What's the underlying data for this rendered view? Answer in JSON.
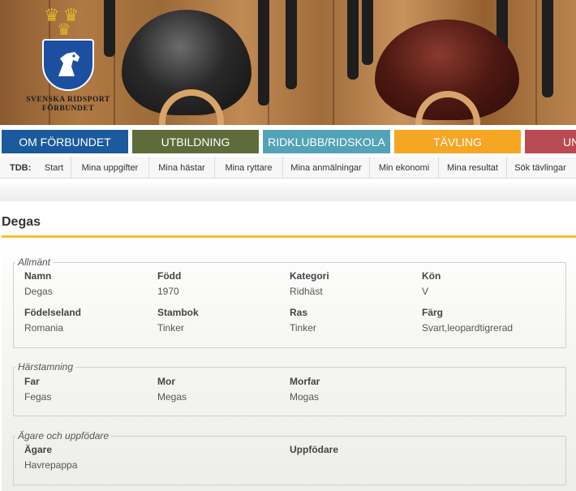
{
  "logo": {
    "line1": "SVENSKA RIDSPORT",
    "line2": "FÖRBUNDET"
  },
  "main_nav": [
    {
      "label": "OM FÖRBUNDET",
      "color": "#1b5a9c"
    },
    {
      "label": "UTBILDNING",
      "color": "#5f6b3a"
    },
    {
      "label": "RIDKLUBB/RIDSKOLA",
      "color": "#53a3b6"
    },
    {
      "label": "TÄVLING",
      "color": "#f5a623"
    },
    {
      "label": "UN",
      "color": "#b84a52"
    }
  ],
  "sub_nav": {
    "label": "TDB:",
    "items": [
      "Start",
      "Mina uppgifter",
      "Mina hästar",
      "Mina ryttare",
      "Mina anmälningar",
      "Min ekonomi",
      "Mina resultat",
      "Sök tävlingar"
    ]
  },
  "page": {
    "title": "Degas"
  },
  "general": {
    "legend": "Allmänt",
    "fields": [
      {
        "label": "Namn",
        "value": "Degas"
      },
      {
        "label": "Född",
        "value": "1970"
      },
      {
        "label": "Kategori",
        "value": "Ridhäst"
      },
      {
        "label": "Kön",
        "value": "V"
      },
      {
        "label": "Födelseland",
        "value": "Romania"
      },
      {
        "label": "Stambok",
        "value": "Tinker"
      },
      {
        "label": "Ras",
        "value": "Tinker"
      },
      {
        "label": "Färg",
        "value": "Svart,leopardtigrerad"
      }
    ]
  },
  "pedigree": {
    "legend": "Härstamning",
    "fields": [
      {
        "label": "Far",
        "value": "Fegas"
      },
      {
        "label": "Mor",
        "value": "Megas"
      },
      {
        "label": "Morfar",
        "value": "Mogas"
      }
    ]
  },
  "owner": {
    "legend": "Ägare och uppfödare",
    "fields": [
      {
        "label": "Ägare",
        "value": "Havrepappa"
      },
      {
        "label": "Uppfödare",
        "value": ""
      }
    ]
  },
  "colors": {
    "accent_rule": "#f2c227",
    "shield": "#1d4fa0",
    "crown": "#e2b52a"
  }
}
